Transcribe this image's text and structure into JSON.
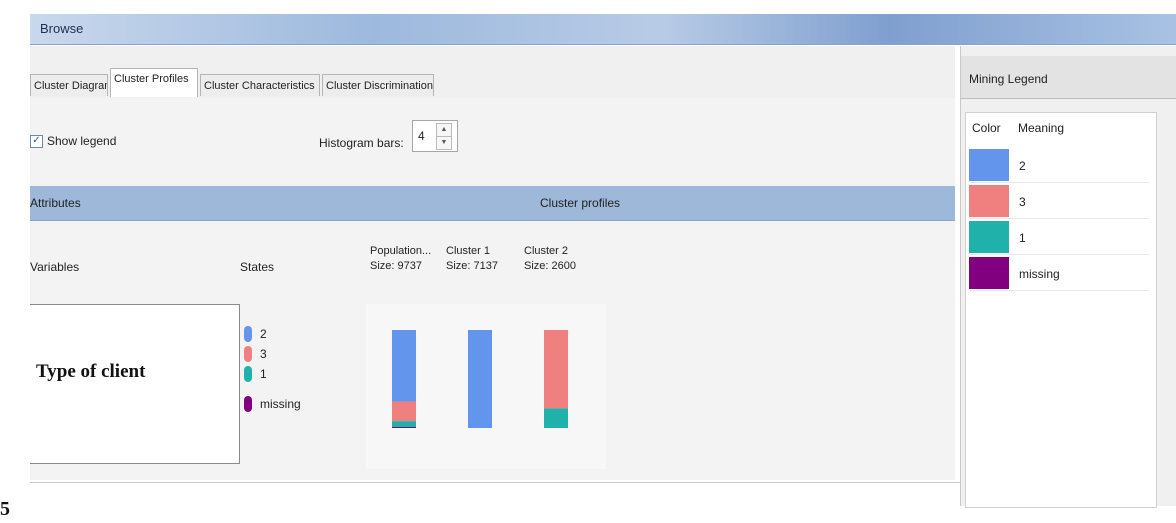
{
  "window": {
    "title": "Browse"
  },
  "tabs": [
    {
      "label": "Cluster Diagram",
      "active": false
    },
    {
      "label": "Cluster Profiles",
      "active": true
    },
    {
      "label": "Cluster Characteristics",
      "active": false
    },
    {
      "label": "Cluster Discrimination",
      "active": false
    }
  ],
  "toolbar": {
    "show_legend_label": "Show legend",
    "show_legend_checked": true,
    "histogram_label": "Histogram bars:",
    "histogram_value": "4"
  },
  "grid": {
    "attributes_header": "Attributes",
    "profiles_header": "Cluster profiles",
    "variables_header": "Variables",
    "states_header": "States",
    "columns": [
      {
        "line1": "Population...",
        "line2": "Size: 9737"
      },
      {
        "line1": "Cluster 1",
        "line2": "Size: 7137"
      },
      {
        "line1": "Cluster 2",
        "line2": "Size: 2600"
      }
    ],
    "variable_name": "Type of client",
    "states": [
      {
        "label": "2",
        "color": "#6495ed"
      },
      {
        "label": "3",
        "color": "#f08080"
      },
      {
        "label": "1",
        "color": "#20b2aa"
      },
      {
        "label": "missing",
        "color": "#800080"
      }
    ]
  },
  "chart_data": {
    "type": "bar",
    "stacked": true,
    "categories": [
      "Population...",
      "Cluster 1",
      "Cluster 2"
    ],
    "series": [
      {
        "name": "2",
        "color": "#6495ed",
        "values": [
          0.73,
          1.0,
          0.0
        ]
      },
      {
        "name": "3",
        "color": "#f08080",
        "values": [
          0.2,
          0.0,
          0.8
        ]
      },
      {
        "name": "1",
        "color": "#20b2aa",
        "values": [
          0.06,
          0.0,
          0.2
        ]
      },
      {
        "name": "missing",
        "color": "#800080",
        "values": [
          0.01,
          0.0,
          0.0
        ]
      }
    ],
    "ylim": [
      0,
      1
    ]
  },
  "legend": {
    "title": "Mining Legend",
    "color_header": "Color",
    "meaning_header": "Meaning",
    "rows": [
      {
        "meaning": "2",
        "color": "#6495ed"
      },
      {
        "meaning": "3",
        "color": "#f08080"
      },
      {
        "meaning": "1",
        "color": "#20b2aa"
      },
      {
        "meaning": "missing",
        "color": "#800080"
      }
    ]
  },
  "page_number": "5"
}
